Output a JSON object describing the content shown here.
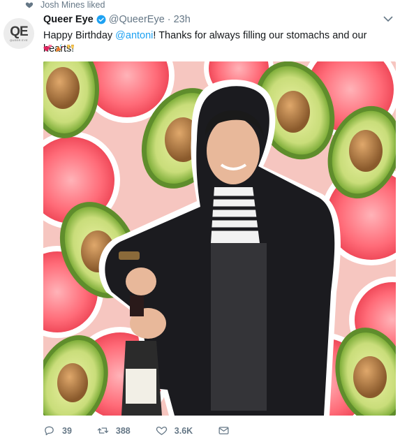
{
  "social_context": {
    "text": "Josh Mines liked",
    "icon": "heart-icon"
  },
  "tweet": {
    "author_name": "Queer Eye",
    "author_handle": "@QueerEye",
    "separator": "·",
    "timestamp": "23h",
    "text_before": "Happy Birthday ",
    "mention": "@antoni",
    "text_after": "! Thanks for always filling our stomachs and our hearts!",
    "emojis": [
      "two-hearts-emoji",
      "party-popper-emoji",
      "clinking-glasses-emoji"
    ],
    "avatar_text": "QE",
    "avatar_subtext": "QUEER EYE"
  },
  "actions": {
    "reply_count": "39",
    "retweet_count": "388",
    "like_count": "3.6K"
  },
  "colors": {
    "accent": "#1da1f2",
    "muted": "#657786",
    "grapefruit": "#ff5c6c",
    "avocado": "#a6c95a"
  }
}
